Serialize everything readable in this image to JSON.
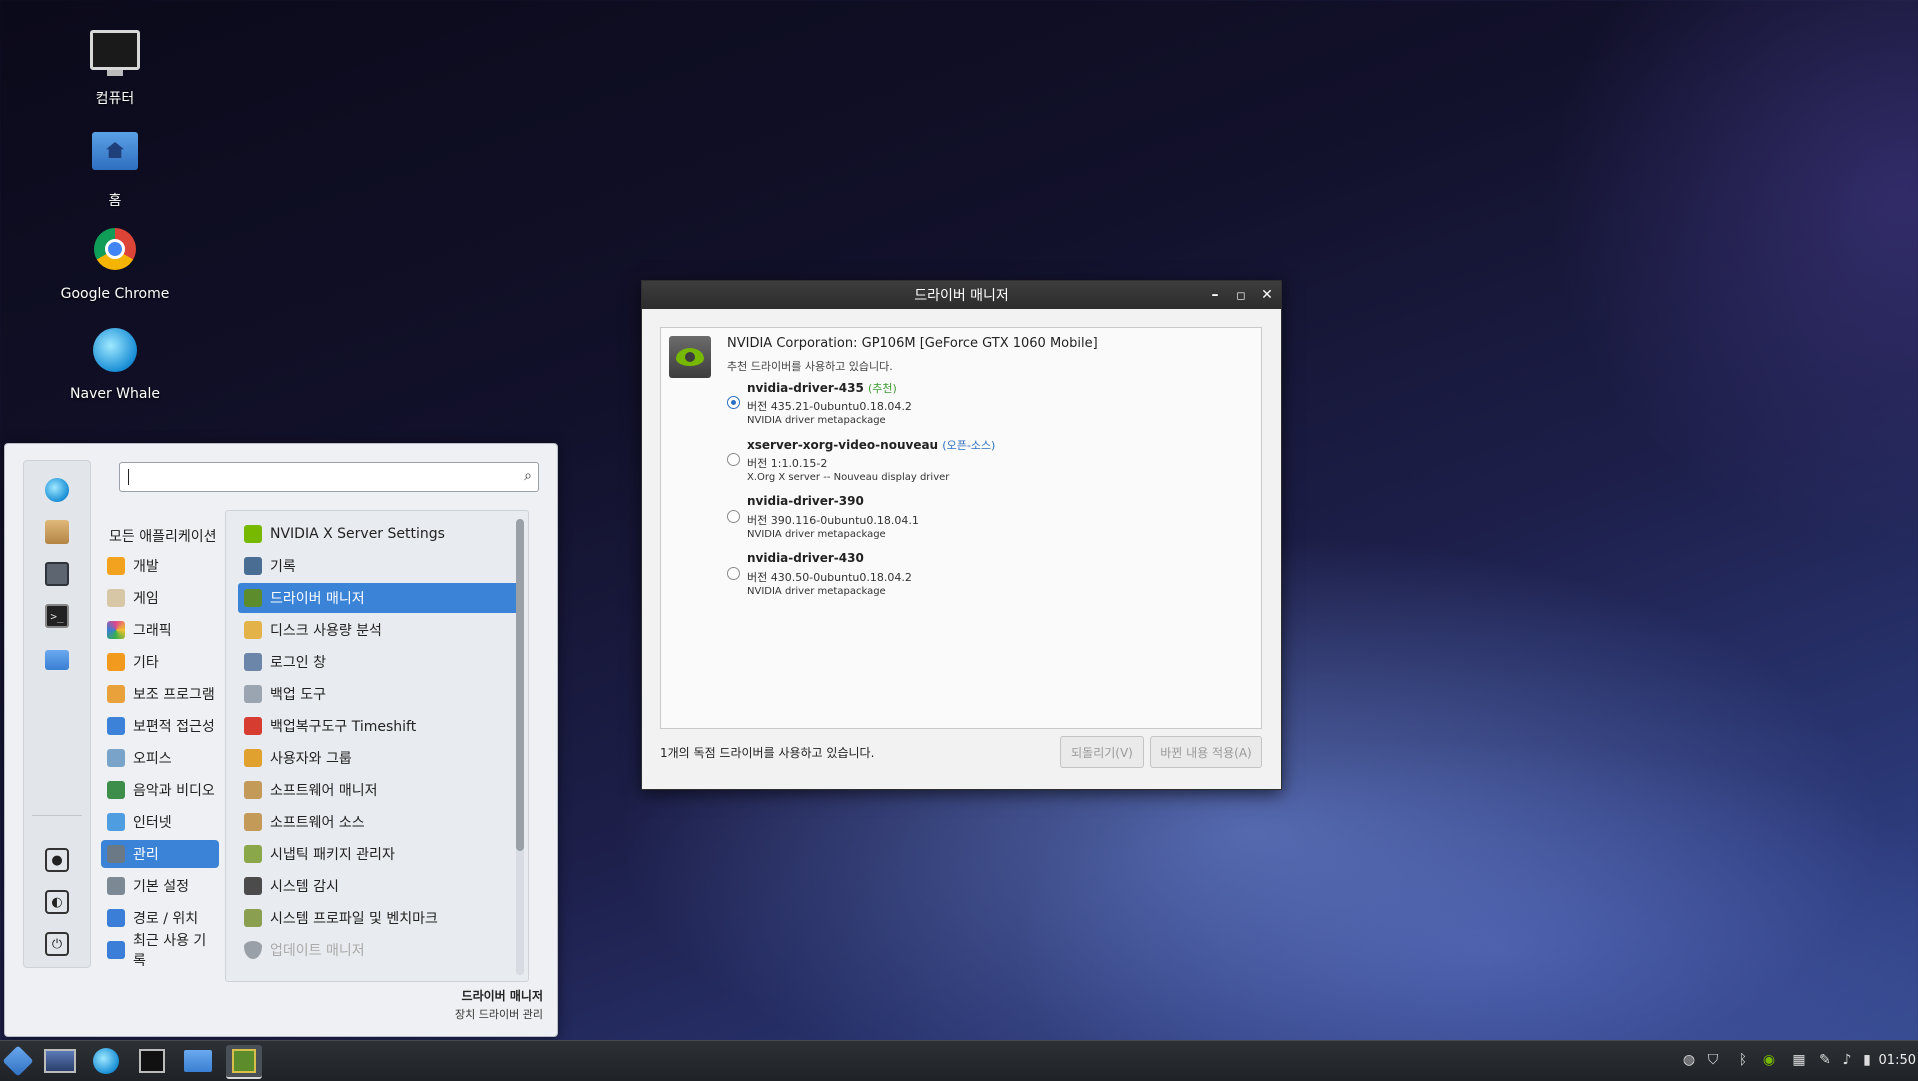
{
  "desktop": {
    "icons": [
      {
        "label": "컴퓨터",
        "icon": "computer-icon"
      },
      {
        "label": "홈",
        "icon": "home-folder-icon"
      },
      {
        "label": "Google Chrome",
        "icon": "chrome-icon"
      },
      {
        "label": "Naver Whale",
        "icon": "whale-icon"
      }
    ]
  },
  "menu": {
    "search_placeholder": "",
    "categories": [
      {
        "label": "모든 애플리케이션"
      },
      {
        "label": "개발",
        "color": "#f2a21e"
      },
      {
        "label": "게임",
        "color": "#d7c7a7"
      },
      {
        "label": "그래픽",
        "color": "#e1478c"
      },
      {
        "label": "기타",
        "color": "#f29a1e"
      },
      {
        "label": "보조 프로그램",
        "color": "#e9a23b"
      },
      {
        "label": "보편적 접근성",
        "color": "#3b82d8"
      },
      {
        "label": "오피스",
        "color": "#7aa3c9"
      },
      {
        "label": "음악과 비디오",
        "color": "#3e8e4b"
      },
      {
        "label": "인터넷",
        "color": "#4d9de0"
      },
      {
        "label": "관리",
        "color": "#6b7885",
        "selected": true
      },
      {
        "label": "기본 설정",
        "color": "#7c8894"
      },
      {
        "label": "경로 / 위치",
        "color": "#3b7ed8"
      },
      {
        "label": "최근 사용 기록",
        "color": "#3b7ed8"
      }
    ],
    "apps": [
      {
        "label": "NVIDIA X Server Settings",
        "color": "#76b900"
      },
      {
        "label": "기록",
        "color": "#4a6d94"
      },
      {
        "label": "드라이버 매니저",
        "color": "#5c8c2c",
        "selected": true
      },
      {
        "label": "디스크 사용량 분석",
        "color": "#e3b34a"
      },
      {
        "label": "로그인 창",
        "color": "#6b86a8"
      },
      {
        "label": "백업 도구",
        "color": "#9aa5b1"
      },
      {
        "label": "백업복구도구 Timeshift",
        "color": "#d63c2f"
      },
      {
        "label": "사용자와 그룹",
        "color": "#e0a12e"
      },
      {
        "label": "소프트웨어 매니저",
        "color": "#c49a58"
      },
      {
        "label": "소프트웨어 소스",
        "color": "#c49a58"
      },
      {
        "label": "시냅틱 패키지 관리자",
        "color": "#8aa84a"
      },
      {
        "label": "시스템 감시",
        "color": "#4b4b4b"
      },
      {
        "label": "시스템 프로파일 및 벤치마크",
        "color": "#8aa050"
      },
      {
        "label": "업데이트 매니저",
        "color": "#9aa0a8",
        "dim": true
      }
    ],
    "description_title": "드라이버 매니저",
    "description_sub": "장치 드라이버 관리"
  },
  "window": {
    "title": "드라이버 매니저",
    "device_name": "NVIDIA Corporation: GP106M [GeForce GTX 1060 Mobile]",
    "device_note": "추천 드라이버를 사용하고 있습니다.",
    "drivers": [
      {
        "name": "nvidia-driver-435",
        "tag": "(추천)",
        "version": "버전 435.21-0ubuntu0.18.04.2",
        "package": "NVIDIA driver metapackage",
        "selected": true
      },
      {
        "name": "xserver-xorg-video-nouveau",
        "tag": "(오픈-소스)",
        "version": "버전 1:1.0.15-2",
        "package": "X.Org X server -- Nouveau display driver",
        "selected": false
      },
      {
        "name": "nvidia-driver-390",
        "tag": "",
        "version": "버전 390.116-0ubuntu0.18.04.1",
        "package": "NVIDIA driver metapackage",
        "selected": false
      },
      {
        "name": "nvidia-driver-430",
        "tag": "",
        "version": "버전 430.50-0ubuntu0.18.04.2",
        "package": "NVIDIA driver metapackage",
        "selected": false
      }
    ],
    "status": "1개의 독점 드라이버를 사용하고 있습니다.",
    "revert_label": "되돌리기(V)",
    "apply_label": "바뀐 내용 적용(A)"
  },
  "taskbar": {
    "clock": "01:50"
  }
}
